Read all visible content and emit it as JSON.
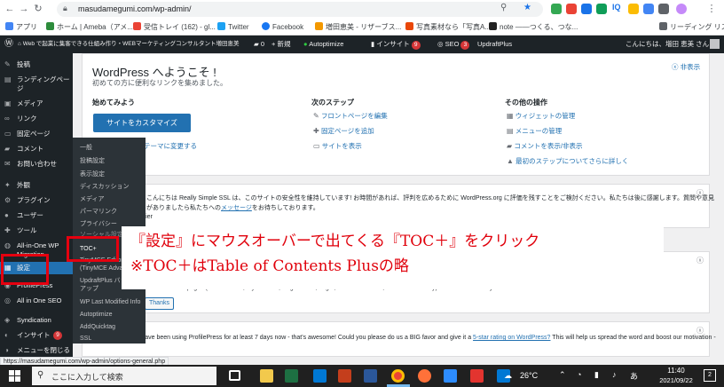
{
  "browser": {
    "url": "masudamegumi.com/wp-admin/",
    "bookmarks": [
      "アプリ",
      "ホーム | Ameba（アメ...",
      "受信トレイ (162) - gl...",
      "Twitter",
      "Facebook",
      "増田恵美 - リザーブス...",
      "写真素材なら「写真A...",
      "note ――つくる、つな...",
      "リーディング リスト"
    ],
    "status_url": "https://masudamegumi.com/wp-admin/options-general.php"
  },
  "adminbar": {
    "site": "Web で起業に集客できる仕組み作り・WEBマーケティングコンサルタント増田恵美",
    "comments": "0",
    "new": "+ 新規",
    "autoptimize": "Autoptimize",
    "insight": "インサイト",
    "insight_badge": "9",
    "seo": "SEO",
    "seo_badge": "3",
    "updraft": "UpdraftPlus",
    "greeting": "こんにちは、増田 恵美 さん"
  },
  "sidebar": {
    "items": [
      {
        "icon": "pin-icon",
        "glyph": "✎",
        "label": "投稿"
      },
      {
        "icon": "page-icon",
        "glyph": "▤",
        "label": "ランディングペー"
      },
      {
        "icon": "",
        "glyph": "",
        "label": "ジ"
      },
      {
        "icon": "media-icon",
        "glyph": "▣",
        "label": "メディア"
      },
      {
        "icon": "link-icon",
        "glyph": "∞",
        "label": "リンク"
      },
      {
        "icon": "pages-icon",
        "glyph": "▭",
        "label": "固定ページ"
      },
      {
        "icon": "comment-icon",
        "glyph": "▰",
        "label": "コメント"
      },
      {
        "icon": "mail-icon",
        "glyph": "✉",
        "label": "お問い合わせ"
      },
      {
        "icon": "appearance-icon",
        "glyph": "✦",
        "label": "外観"
      },
      {
        "icon": "plugin-icon",
        "glyph": "⚙",
        "label": "プラグイン"
      },
      {
        "icon": "user-icon",
        "glyph": "●",
        "label": "ユーザー"
      },
      {
        "icon": "tool-icon",
        "glyph": "✚",
        "label": "ツール"
      },
      {
        "icon": "migration-icon",
        "glyph": "◍",
        "label": "All-in-One WP"
      },
      {
        "icon": "",
        "glyph": "",
        "label": "Migration"
      },
      {
        "icon": "settings-icon",
        "glyph": "▦",
        "label": "設定"
      },
      {
        "icon": "profilepress-icon",
        "glyph": "◉",
        "label": "ProfilePress"
      },
      {
        "icon": "seo-icon",
        "glyph": "◎",
        "label": "All in One SEO"
      },
      {
        "icon": "syndication-icon",
        "glyph": "◈",
        "label": "Syndication"
      },
      {
        "icon": "insight-icon",
        "glyph": "◐",
        "label": "インサイト"
      },
      {
        "icon": "menu-icon",
        "glyph": "◑",
        "label": "メニューを閉じる"
      }
    ],
    "insight_badge": "9"
  },
  "submenu": {
    "items": [
      "一般",
      "投稿設定",
      "表示設定",
      "ディスカッション",
      "メディア",
      "パーマリンク",
      "プライバシー",
      "ソーシャル設定",
      "TOC+",
      "TinyMCE Editor",
      "(TinyMCE Advanced)",
      "UpdraftPlus バック",
      "アップ",
      "WP Last Modified Info",
      "Autoptimize",
      "AddQuicktag",
      "SSL"
    ]
  },
  "welcome": {
    "title": "WordPress へようこそ !",
    "subtitle": "初めての方に便利なリンクを集めました。",
    "hide": "非表示",
    "col1": {
      "heading": "始めてみよう",
      "button": "サイトをカスタマイズ",
      "link": "別のテーマに変更する"
    },
    "col2": {
      "heading": "次のステップ",
      "links": [
        "フロントページを編集",
        "固定ページを追加",
        "サイトを表示"
      ]
    },
    "col3": {
      "heading": "その他の操作",
      "links": [
        "ウィジェットの管理",
        "メニューの管理",
        "コメントを表示/非表示",
        "最初のステップについてさらに詳しく"
      ]
    }
  },
  "notice1": {
    "line1": "こんにちは Really Simple SSL は、このサイトの安全性を維持しています! お時間があれば、評判を広めるために WordPress.org に評価を残すことをご検討ください。私たちは後に感謝します。質問や意見",
    "line2_pre": "がありましたら私たちへの",
    "line2_link": "メッセージ",
    "line2_post": "をお待ちしております。",
    "line3": "- Rogier"
  },
  "notice2": {
    "line1": "Create several pages (User Profiles, My Account, Registration, Login, Password Reset, Member Directory) to function correctly.",
    "button": "Thanks"
  },
  "notice3": {
    "pre": "We have been using ProfilePress for at least 7 days now - that's awesome! Could you please do us a BIG favor and give it a",
    "link": "5-star rating on WordPress?",
    "post": "This will help us spread the word and boost our motivation -"
  },
  "callout": {
    "line1": "『設定』にマウスオーバーで出てくる『TOC＋』をクリック",
    "line2": "※TOC＋はTable of Contents Plusの略"
  },
  "taskbar": {
    "search_placeholder": "ここに入力して検索",
    "weather": "26°C",
    "ime": "あ",
    "time": "11:40",
    "date": "2021/09/22",
    "notifications": "2"
  }
}
